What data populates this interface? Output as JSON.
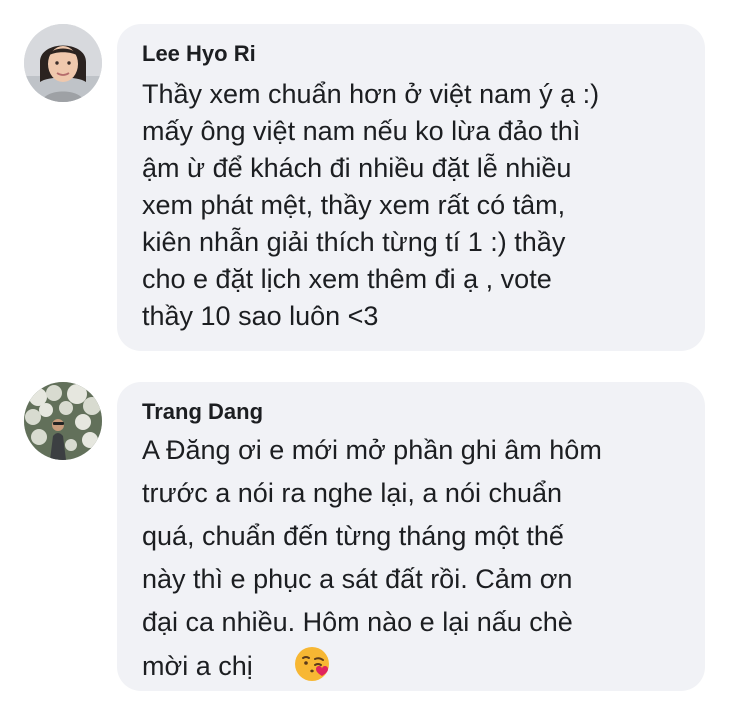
{
  "status_bar": {
    "left_hint": "",
    "center_hint": "",
    "right_hint": ""
  },
  "comments": [
    {
      "author": "Lee Hyo Ri",
      "lines": [
        "Thầy xem chuẩn hơn ở việt nam ý ạ :)",
        "mấy ông việt nam nếu ko lừa đảo thì",
        "ậm ừ để khách đi nhiều đặt lễ nhiều",
        "xem phát mệt, thầy xem rất có tâm,",
        "kiên nhẫn giải thích từng tí 1 :) thầy",
        "cho e đặt lịch xem thêm đi ạ , vote",
        "thầy 10 sao luôn <3"
      ],
      "avatar": "profile-photo-woman-icon"
    },
    {
      "author": "Trang Dang",
      "lines": [
        "A Đăng ơi e mới mở phần ghi âm hôm",
        "trước a nói ra nghe lại, a nói chuẩn",
        "quá, chuẩn đến từng tháng một thế",
        "này thì e phục a sát đất rồi. Cảm ơn",
        "đại ca nhiều. Hôm nào e lại nấu chè",
        "mời a chị"
      ],
      "avatar": "profile-photo-outdoor-icon",
      "emoji": "face-blowing-kiss-icon"
    }
  ],
  "colors": {
    "bubble": "#f1f2f6",
    "text": "#1c1e21",
    "emoji_face": "#f7b733",
    "emoji_heart": "#e0245e"
  }
}
